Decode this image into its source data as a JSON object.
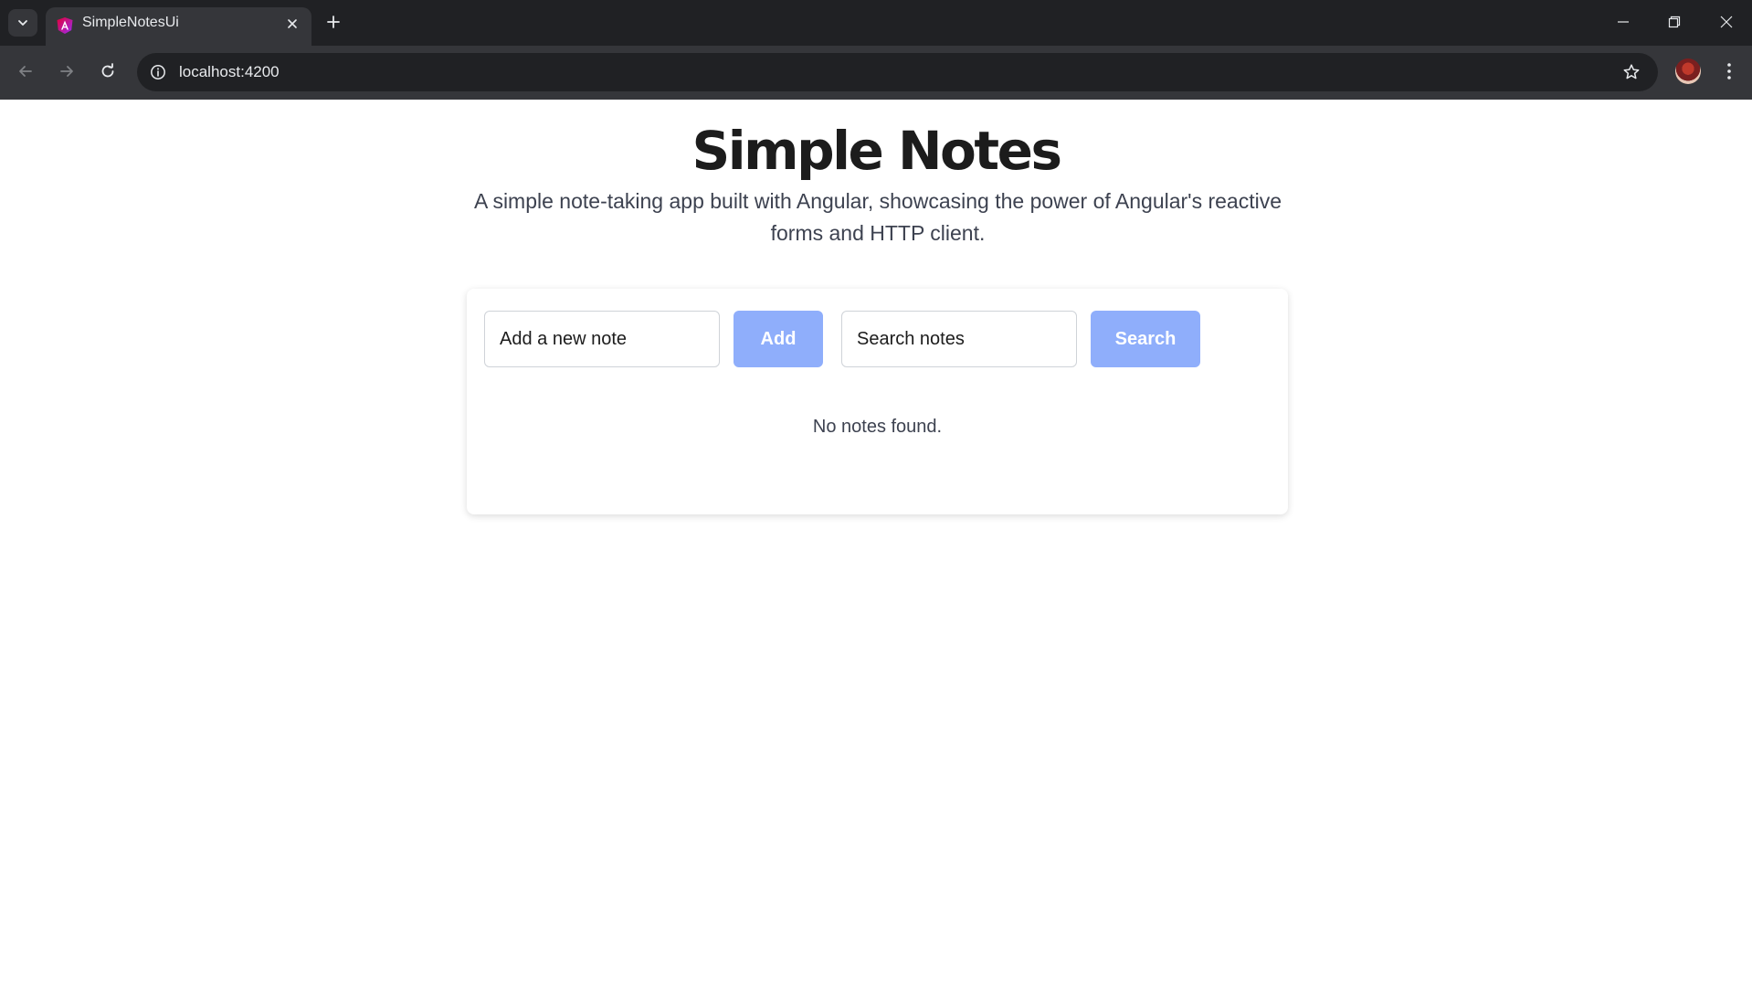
{
  "browser": {
    "tab": {
      "title": "SimpleNotesUi"
    },
    "address_bar": {
      "url": "localhost:4200"
    }
  },
  "page": {
    "title": "Simple Notes",
    "subtitle": "A simple note-taking app built with Angular, showcasing the power of Angular's reactive forms and HTTP client."
  },
  "notes_panel": {
    "add_input": {
      "placeholder": "Add a new note",
      "value": ""
    },
    "add_button": {
      "label": "Add"
    },
    "search_input": {
      "placeholder": "Search notes",
      "value": ""
    },
    "search_button": {
      "label": "Search"
    },
    "empty_message": "No notes found.",
    "notes": []
  },
  "colors": {
    "button_bg": "#8faefb",
    "button_text": "#ffffff",
    "title_text": "#1c1c1c",
    "chrome_dark": "#202124",
    "chrome_toolbar": "#35363a"
  },
  "icons": {
    "tab_search": "chevron-down-icon",
    "favicon": "angular-logo-icon",
    "tab_close": "close-icon",
    "new_tab": "plus-icon",
    "back": "arrow-left-icon",
    "forward": "arrow-right-icon",
    "reload": "reload-icon",
    "site_info": "info-icon",
    "bookmark": "star-icon",
    "menu": "kebab-menu-icon",
    "minimize": "minimize-icon",
    "restore": "restore-icon",
    "close_window": "close-icon"
  }
}
